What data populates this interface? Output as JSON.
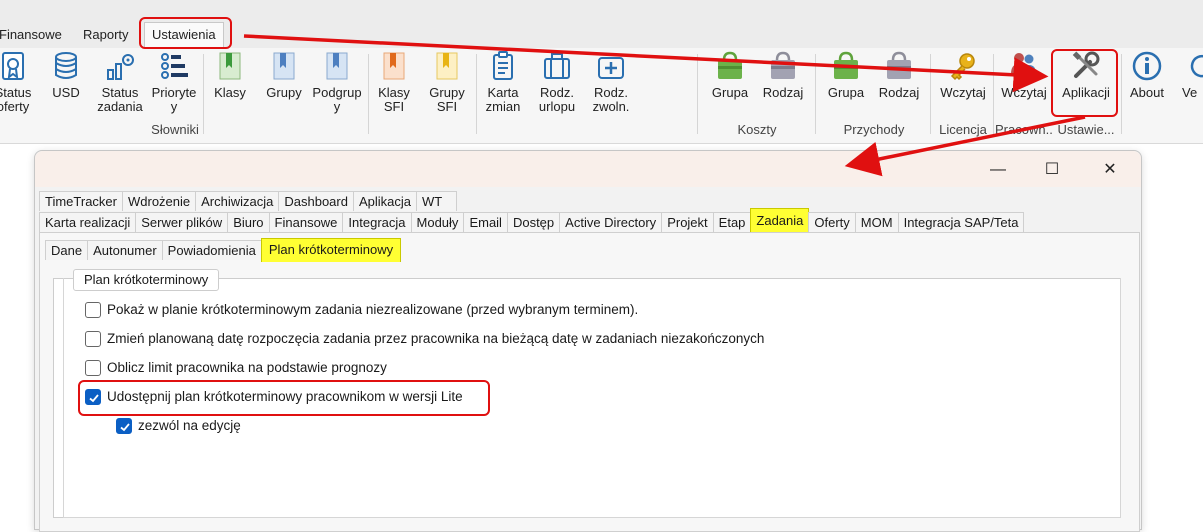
{
  "menu": {
    "tabs": [
      "Finansowe",
      "Raporty",
      "Ustawienia"
    ]
  },
  "ribbon": {
    "buttons": {
      "status_oferty": "Status\noferty",
      "usd": "USD",
      "status_zadania": "Status\nzadania",
      "priorytety": "Prioryteт\ny",
      "klasy": "Klasy",
      "grupy": "Grupy",
      "podgrupy": "Podgrup\ny",
      "klasy_sfi": "Klasy\nSFI",
      "grupy_sfi": "Grupy\nSFI",
      "karta_zmian": "Karta\nzmian",
      "rodz_urlopu": "Rodz.\nurlopu",
      "rodz_zwoln": "Rodz.\nzwoln.",
      "koszty_grupa": "Grupa",
      "koszty_rodzaj": "Rodzaj",
      "przychody_grupa": "Grupa",
      "przychody_rodzaj": "Rodzaj",
      "licencja_wczytaj": "Wczytaj",
      "pracownicy_wczytaj": "Wczytaj",
      "aplikacji": "Aplikacji",
      "about": "About",
      "ve": "Ve"
    },
    "groups": {
      "slowniki": "Słowniki",
      "koszty": "Koszty",
      "przychody": "Przychody",
      "licencja": "Licencja",
      "pracownicy": "Pracown...",
      "ustawienia": "Ustawie..."
    }
  },
  "dialog": {
    "controls": {
      "minimize": "—",
      "maximize": "☐",
      "close": "✕"
    },
    "tabs_row1": [
      "TimeTracker",
      "Wdrożenie",
      "Archiwizacja",
      "Dashboard",
      "Aplikacja",
      "WT"
    ],
    "tabs_row2": [
      "Karta realizacji",
      "Serwer plików",
      "Biuro",
      "Finansowe",
      "Integracja",
      "Moduły",
      "Email",
      "Dostęp",
      "Active Directory",
      "Projekt",
      "Etap",
      "Zadania",
      "Oferty",
      "MOM",
      "Integracja SAP/Teta"
    ],
    "subtabs": [
      "Dane",
      "Autonumer",
      "Powiadomienia",
      "Plan krótkoterminowy"
    ],
    "group_title": "Plan krótkoterminowy",
    "options": [
      {
        "label": "Pokaż w planie krótkoterminowym zadania niezrealizowane (przed wybranym terminem).",
        "checked": false
      },
      {
        "label": "Zmień planowaną datę rozpoczęcia zadania przez pracownika na bieżącą datę w zadaniach niezakończonych",
        "checked": false
      },
      {
        "label": "Oblicz limit pracownika na podstawie prognozy",
        "checked": false
      },
      {
        "label": "Udostępnij plan krótkoterminowy pracownikom w wersji Lite",
        "checked": true
      },
      {
        "label": "zezwól na edycję",
        "checked": true
      }
    ]
  },
  "colors": {
    "highlight": "#ffff33",
    "annotation_red": "#e01010",
    "checkbox_blue": "#0b5fc4"
  }
}
